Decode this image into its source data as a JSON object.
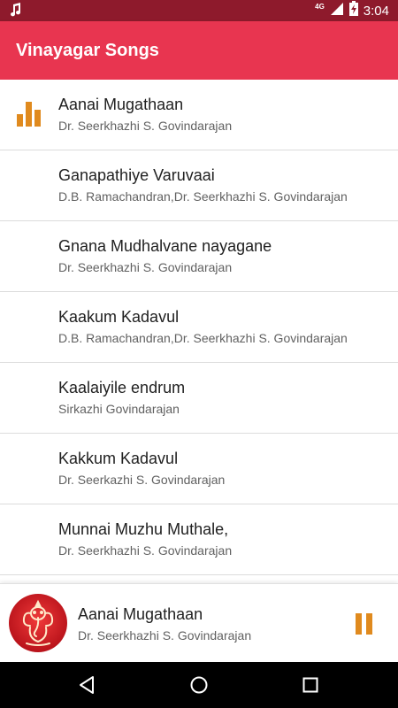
{
  "status_bar": {
    "network": "4G",
    "time": "3:04"
  },
  "app_bar": {
    "title": "Vinayagar Songs"
  },
  "songs": [
    {
      "title": "Aanai Mugathaan",
      "artist": "Dr. Seerkhazhi S. Govindarajan",
      "playing": true
    },
    {
      "title": "Ganapathiye Varuvaai",
      "artist": "D.B. Ramachandran,Dr. Seerkhazhi S. Govindarajan",
      "playing": false
    },
    {
      "title": "Gnana Mudhalvane nayagane",
      "artist": "Dr. Seerkhazhi S. Govindarajan",
      "playing": false
    },
    {
      "title": "Kaakum Kadavul",
      "artist": "D.B. Ramachandran,Dr. Seerkhazhi S. Govindarajan",
      "playing": false
    },
    {
      "title": "Kaalaiyile endrum",
      "artist": "Sirkazhi Govindarajan",
      "playing": false
    },
    {
      "title": "Kakkum Kadavul",
      "artist": "Dr. Seerkazhi S. Govindarajan",
      "playing": false
    },
    {
      "title": "Munnai Muzhu Muthale,",
      "artist": "Dr. Seerkhazhi S. Govindarajan",
      "playing": false
    }
  ],
  "now_playing": {
    "title": "Aanai Mugathaan",
    "artist": "Dr. Seerkhazhi S. Govindarajan"
  },
  "colors": {
    "status_bar": "#8e1a2c",
    "app_bar": "#e83550",
    "accent": "#e08a1e"
  },
  "icons": {
    "status_left": "music-note-icon",
    "signal": "signal-icon",
    "battery": "battery-charging-icon",
    "now_playing_indicator": "equalizer-icon",
    "mini_player_action": "pause-icon",
    "nav": [
      "back-icon",
      "home-icon",
      "recents-icon"
    ]
  }
}
